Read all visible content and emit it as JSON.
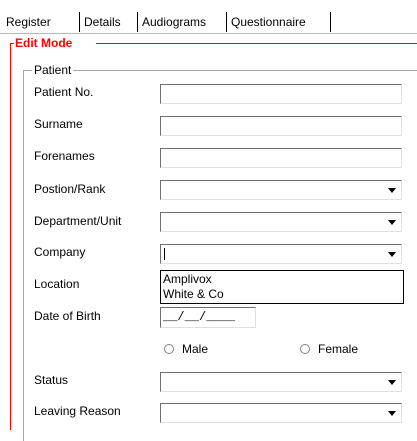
{
  "tabs": [
    {
      "label": "Register"
    },
    {
      "label": "Details"
    },
    {
      "label": "Audiograms"
    },
    {
      "label": "Questionnaire"
    }
  ],
  "edit_mode": {
    "label": "Edit Mode"
  },
  "patient_group": {
    "label": "Patient"
  },
  "fields": {
    "patient_no": {
      "label": "Patient No.",
      "value": ""
    },
    "surname": {
      "label": "Surname",
      "value": ""
    },
    "forenames": {
      "label": "Forenames",
      "value": ""
    },
    "position_rank": {
      "label": "Postion/Rank",
      "value": ""
    },
    "department_unit": {
      "label": "Department/Unit",
      "value": ""
    },
    "company": {
      "label": "Company",
      "value": "",
      "options": [
        "Amplivox",
        "White & Co"
      ]
    },
    "location": {
      "label": "Location"
    },
    "date_of_birth": {
      "label": "Date of Birth",
      "value": "__/__/____"
    },
    "status": {
      "label": "Status",
      "value": ""
    },
    "leaving_reason": {
      "label": "Leaving Reason",
      "value": ""
    }
  },
  "gender": {
    "male_label": "Male",
    "female_label": "Female"
  },
  "colors": {
    "edit_mode": "#ff0000",
    "border": "#a8a8a8"
  }
}
